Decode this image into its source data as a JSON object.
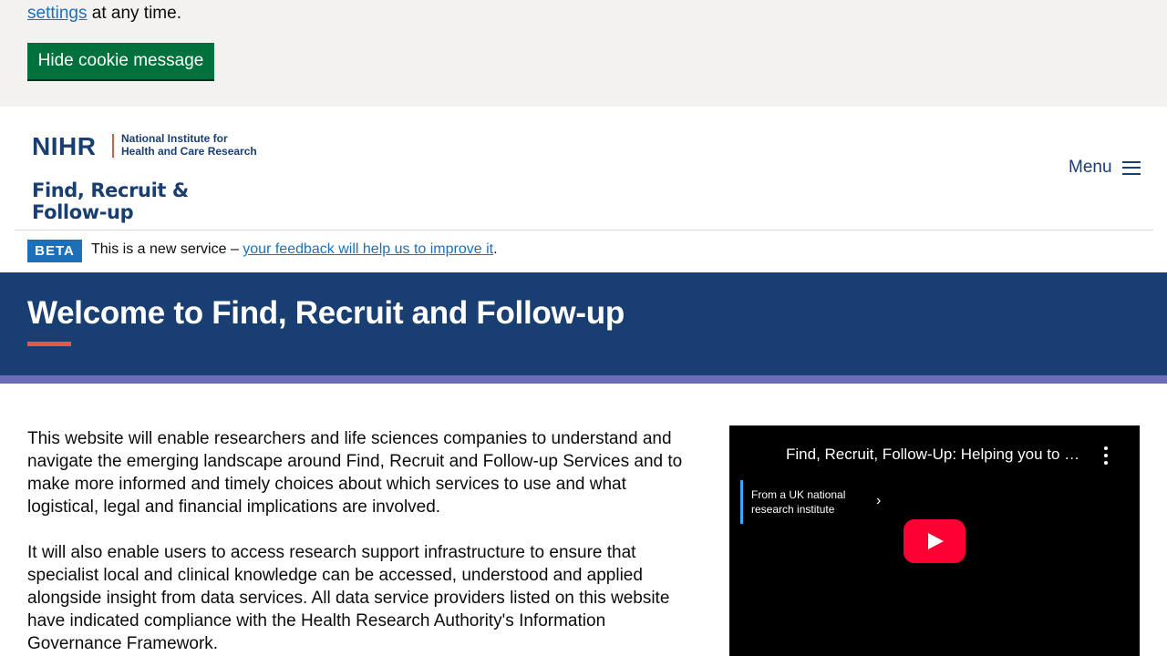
{
  "cookie_banner": {
    "text_link": "settings",
    "text_rest": " at any time.",
    "hide_button": "Hide cookie message"
  },
  "header": {
    "logo_abbrev": "NIHR",
    "logo_institute_line1": "National Institute for",
    "logo_institute_line2": "Health and Care Research",
    "service_name": "Find, Recruit & Follow-up",
    "menu_label": "Menu"
  },
  "beta_banner": {
    "tag": "BETA",
    "text_prefix": "This is a new service – ",
    "feedback_link": "your feedback will help us to improve it",
    "text_suffix": "."
  },
  "hero": {
    "title": "Welcome to Find, Recruit and Follow-up"
  },
  "main": {
    "paragraphs": [
      "This website will enable researchers and life sciences companies to understand and navigate the emerging landscape around Find, Recruit and Follow-up Services and to make more informed and timely choices about which services to use and what logistical, legal and financial implications are involved.",
      "It will also enable users to access research support infrastructure to ensure that specialist local and clinical knowledge can be accessed, understood and applied alongside insight from data services. All data service providers listed on this website have indicated compliance with the Health Research Authority's Information Governance Framework."
    ]
  },
  "video": {
    "title": "Find, Recruit, Follow-Up: Helping you to …",
    "info_line1": "From a UK national",
    "info_line2": "research institute"
  },
  "colors": {
    "brand_navy": "#193e72",
    "accent_red": "#e05a44",
    "stripe_purple": "#6a6cb5",
    "link_blue": "#1d70b8",
    "button_green": "#00703c"
  }
}
